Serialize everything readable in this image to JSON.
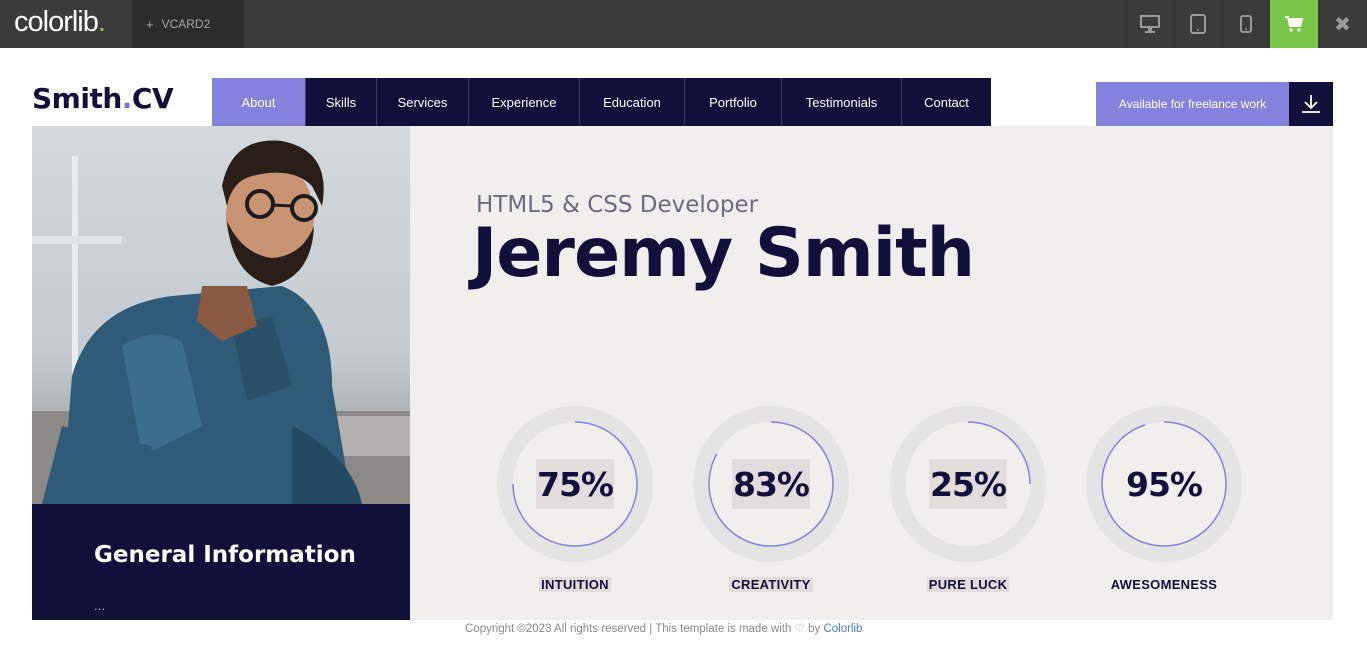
{
  "topbar": {
    "brand": "colorlib",
    "brand_dot": ".",
    "tab_plus": "+",
    "tab_label": "VCARD2",
    "close_symbol": "✖"
  },
  "site": {
    "logo_main": "Smith",
    "logo_dot": ".",
    "logo_suffix": "CV",
    "nav": [
      "About",
      "Skills",
      "Services",
      "Experience",
      "Education",
      "Portfolio",
      "Testimonials",
      "Contact"
    ],
    "active_nav": "About",
    "freelance_label": "Available for freelance work"
  },
  "hero": {
    "subtitle": "HTML5 & CSS Developer",
    "name": "Jeremy Smith",
    "skills": [
      {
        "label": "INTUITION",
        "value": 75,
        "display": "75%"
      },
      {
        "label": "CREATIVITY",
        "value": 83,
        "display": "83%"
      },
      {
        "label": "PURE LUCK",
        "value": 25,
        "display": "25%"
      },
      {
        "label": "AWESOMENESS",
        "value": 95,
        "display": "95%"
      }
    ]
  },
  "general": {
    "title": "General Information",
    "peek_text": "…"
  },
  "footer": {
    "text_before": "Copyright ©2023 All rights reserved | This template is made with",
    "heart": "♡",
    "by": "by",
    "link": "Colorlib"
  },
  "colors": {
    "accent": "#8582de",
    "navy": "#10103a",
    "hero_bg": "#f1eeee",
    "cart_green": "#7cc84b"
  },
  "icons": [
    "desktop-icon",
    "tablet-icon",
    "mobile-icon",
    "cart-icon",
    "close-icon",
    "download-icon",
    "heart-icon"
  ]
}
